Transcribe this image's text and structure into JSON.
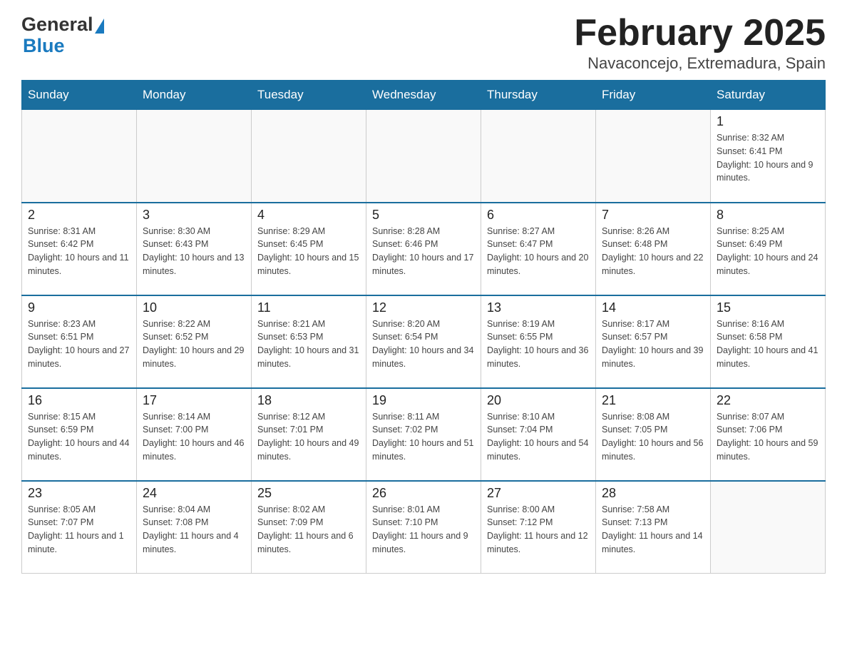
{
  "header": {
    "logo": {
      "text1": "General",
      "text2": "Blue"
    },
    "month_title": "February 2025",
    "location": "Navaconcejo, Extremadura, Spain"
  },
  "days_of_week": [
    "Sunday",
    "Monday",
    "Tuesday",
    "Wednesday",
    "Thursday",
    "Friday",
    "Saturday"
  ],
  "weeks": [
    [
      {
        "day": "",
        "info": ""
      },
      {
        "day": "",
        "info": ""
      },
      {
        "day": "",
        "info": ""
      },
      {
        "day": "",
        "info": ""
      },
      {
        "day": "",
        "info": ""
      },
      {
        "day": "",
        "info": ""
      },
      {
        "day": "1",
        "info": "Sunrise: 8:32 AM\nSunset: 6:41 PM\nDaylight: 10 hours and 9 minutes."
      }
    ],
    [
      {
        "day": "2",
        "info": "Sunrise: 8:31 AM\nSunset: 6:42 PM\nDaylight: 10 hours and 11 minutes."
      },
      {
        "day": "3",
        "info": "Sunrise: 8:30 AM\nSunset: 6:43 PM\nDaylight: 10 hours and 13 minutes."
      },
      {
        "day": "4",
        "info": "Sunrise: 8:29 AM\nSunset: 6:45 PM\nDaylight: 10 hours and 15 minutes."
      },
      {
        "day": "5",
        "info": "Sunrise: 8:28 AM\nSunset: 6:46 PM\nDaylight: 10 hours and 17 minutes."
      },
      {
        "day": "6",
        "info": "Sunrise: 8:27 AM\nSunset: 6:47 PM\nDaylight: 10 hours and 20 minutes."
      },
      {
        "day": "7",
        "info": "Sunrise: 8:26 AM\nSunset: 6:48 PM\nDaylight: 10 hours and 22 minutes."
      },
      {
        "day": "8",
        "info": "Sunrise: 8:25 AM\nSunset: 6:49 PM\nDaylight: 10 hours and 24 minutes."
      }
    ],
    [
      {
        "day": "9",
        "info": "Sunrise: 8:23 AM\nSunset: 6:51 PM\nDaylight: 10 hours and 27 minutes."
      },
      {
        "day": "10",
        "info": "Sunrise: 8:22 AM\nSunset: 6:52 PM\nDaylight: 10 hours and 29 minutes."
      },
      {
        "day": "11",
        "info": "Sunrise: 8:21 AM\nSunset: 6:53 PM\nDaylight: 10 hours and 31 minutes."
      },
      {
        "day": "12",
        "info": "Sunrise: 8:20 AM\nSunset: 6:54 PM\nDaylight: 10 hours and 34 minutes."
      },
      {
        "day": "13",
        "info": "Sunrise: 8:19 AM\nSunset: 6:55 PM\nDaylight: 10 hours and 36 minutes."
      },
      {
        "day": "14",
        "info": "Sunrise: 8:17 AM\nSunset: 6:57 PM\nDaylight: 10 hours and 39 minutes."
      },
      {
        "day": "15",
        "info": "Sunrise: 8:16 AM\nSunset: 6:58 PM\nDaylight: 10 hours and 41 minutes."
      }
    ],
    [
      {
        "day": "16",
        "info": "Sunrise: 8:15 AM\nSunset: 6:59 PM\nDaylight: 10 hours and 44 minutes."
      },
      {
        "day": "17",
        "info": "Sunrise: 8:14 AM\nSunset: 7:00 PM\nDaylight: 10 hours and 46 minutes."
      },
      {
        "day": "18",
        "info": "Sunrise: 8:12 AM\nSunset: 7:01 PM\nDaylight: 10 hours and 49 minutes."
      },
      {
        "day": "19",
        "info": "Sunrise: 8:11 AM\nSunset: 7:02 PM\nDaylight: 10 hours and 51 minutes."
      },
      {
        "day": "20",
        "info": "Sunrise: 8:10 AM\nSunset: 7:04 PM\nDaylight: 10 hours and 54 minutes."
      },
      {
        "day": "21",
        "info": "Sunrise: 8:08 AM\nSunset: 7:05 PM\nDaylight: 10 hours and 56 minutes."
      },
      {
        "day": "22",
        "info": "Sunrise: 8:07 AM\nSunset: 7:06 PM\nDaylight: 10 hours and 59 minutes."
      }
    ],
    [
      {
        "day": "23",
        "info": "Sunrise: 8:05 AM\nSunset: 7:07 PM\nDaylight: 11 hours and 1 minute."
      },
      {
        "day": "24",
        "info": "Sunrise: 8:04 AM\nSunset: 7:08 PM\nDaylight: 11 hours and 4 minutes."
      },
      {
        "day": "25",
        "info": "Sunrise: 8:02 AM\nSunset: 7:09 PM\nDaylight: 11 hours and 6 minutes."
      },
      {
        "day": "26",
        "info": "Sunrise: 8:01 AM\nSunset: 7:10 PM\nDaylight: 11 hours and 9 minutes."
      },
      {
        "day": "27",
        "info": "Sunrise: 8:00 AM\nSunset: 7:12 PM\nDaylight: 11 hours and 12 minutes."
      },
      {
        "day": "28",
        "info": "Sunrise: 7:58 AM\nSunset: 7:13 PM\nDaylight: 11 hours and 14 minutes."
      },
      {
        "day": "",
        "info": ""
      }
    ]
  ]
}
